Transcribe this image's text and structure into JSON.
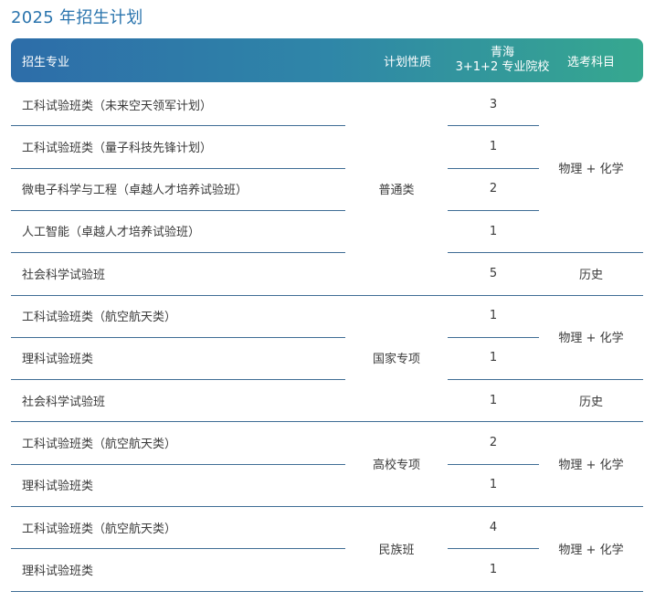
{
  "title": "2025 年招生计划",
  "header": {
    "major": "招生专业",
    "nature": "计划性质",
    "count_line1": "青海",
    "count_line2": "3+1+2 专业院校",
    "subject": "选考科目"
  },
  "rows": [
    {
      "major": "工科试验班类（未来空天领军计划）",
      "count": "3"
    },
    {
      "major": "工科试验班类（量子科技先锋计划）",
      "count": "1"
    },
    {
      "major": "微电子科学与工程（卓越人才培养试验班）",
      "count": "2"
    },
    {
      "major": "人工智能（卓越人才培养试验班）",
      "count": "1"
    },
    {
      "major": "社会科学试验班",
      "count": "5"
    },
    {
      "major": "工科试验班类（航空航天类）",
      "count": "1"
    },
    {
      "major": "理科试验班类",
      "count": "1"
    },
    {
      "major": "社会科学试验班",
      "count": "1"
    },
    {
      "major": "工科试验班类（航空航天类）",
      "count": "2"
    },
    {
      "major": "理科试验班类",
      "count": "1"
    },
    {
      "major": "工科试验班类（航空航天类）",
      "count": "4"
    },
    {
      "major": "理科试验班类",
      "count": "1"
    }
  ],
  "natures": [
    {
      "label": "普通类"
    },
    {
      "label": "国家专项"
    },
    {
      "label": "高校专项"
    },
    {
      "label": "民族班"
    }
  ],
  "subjects": [
    {
      "label": "物理 + 化学"
    },
    {
      "label": "历史"
    },
    {
      "label": "物理 + 化学"
    },
    {
      "label": "历史"
    },
    {
      "label": "物理 + 化学"
    },
    {
      "label": "物理 + 化学"
    }
  ]
}
